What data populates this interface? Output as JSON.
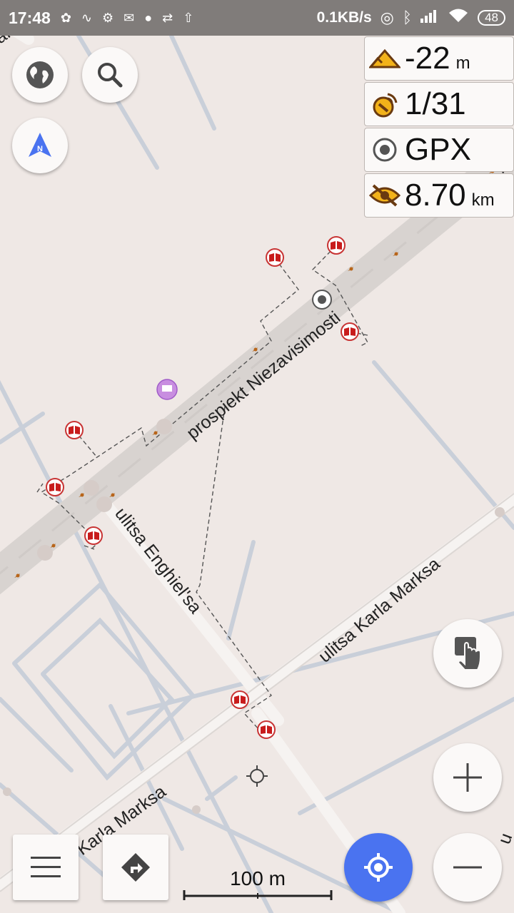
{
  "status_bar": {
    "time": "17:48",
    "net_speed": "0.1KB/s",
    "battery": "48"
  },
  "widgets": {
    "altitude": {
      "value": "-22",
      "unit": "m",
      "icon": "altitude-icon"
    },
    "gps": {
      "value": "1/31",
      "icon": "satellite-icon"
    },
    "gpx": {
      "value": "GPX",
      "icon": "gpx-record-icon"
    },
    "distance": {
      "value": "8.70",
      "unit": "km",
      "icon": "hidden-eye-icon"
    }
  },
  "map": {
    "streets": [
      "prospiekt Niezavisimosti",
      "ulitsa Enghiel'sa",
      "ulitsa Karla Marksa",
      "Karla Marksa"
    ],
    "edge_labels": [
      "alaja ulits",
      "pr",
      "u"
    ]
  },
  "scale_bar": {
    "label": "100 m"
  },
  "colors": {
    "map_background": "#efe8e5",
    "main_road": "#d9d4d1",
    "minor_road": "#c6cdd8",
    "accent_blue": "#4a73f0",
    "status_bar": "#807c7a",
    "library_poi": "#c81c1c"
  }
}
